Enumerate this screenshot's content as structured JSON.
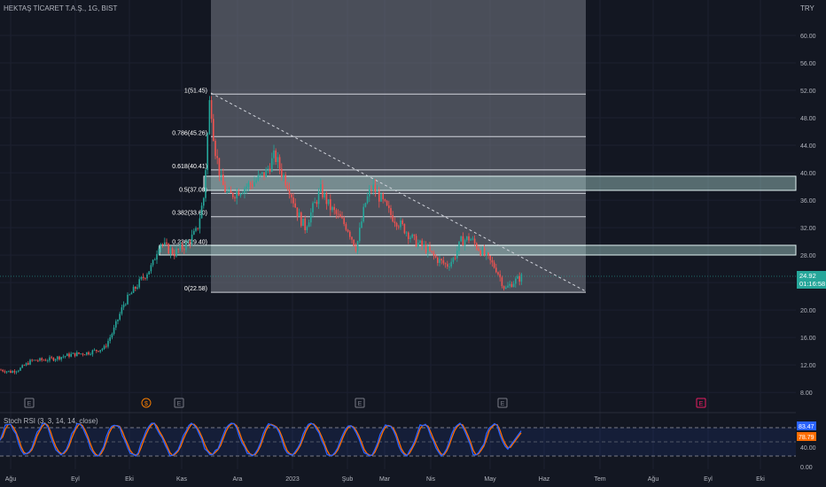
{
  "header": {
    "symbol_title": "HEKTAŞ TİCARET T.A.Ş., 1G, BIST",
    "currency": "TRY"
  },
  "colors": {
    "background": "#131722",
    "grid": "#1c2030",
    "axis_text": "#b2b5be",
    "up": "#26a69a",
    "down": "#ef5350",
    "fib_zone": "#787b86",
    "fib_line": "#d1d4dc",
    "resistance_band": "#b2dfdb",
    "rsi_k": "#2962ff",
    "rsi_d": "#ff6d00",
    "rsi_band": "#2962ff",
    "event_orange": "#f57c00",
    "event_pink": "#e91e63"
  },
  "price_axis": {
    "ticks": [
      "60.00",
      "56.00",
      "52.00",
      "48.00",
      "44.00",
      "40.00",
      "36.00",
      "32.00",
      "28.00",
      "24.00",
      "20.00",
      "16.00",
      "12.00",
      "8.00"
    ]
  },
  "time_axis": {
    "labels": [
      "Ağu",
      "Eyl",
      "Eki",
      "Kas",
      "Ara",
      "2023",
      "Şub",
      "Mar",
      "Nis",
      "May",
      "Haz",
      "Tem",
      "Ağu",
      "Eyl",
      "Eki"
    ]
  },
  "last_price": {
    "value": "24.92",
    "countdown": "01:16:58"
  },
  "fibonacci": {
    "levels": [
      {
        "label": "1(51.45)",
        "price": 51.45
      },
      {
        "label": "0.786(45.26)",
        "price": 45.26
      },
      {
        "label": "0.618(40.41)",
        "price": 40.41
      },
      {
        "label": "0.5(37.00)",
        "price": 37.0
      },
      {
        "label": "0.382(33.60)",
        "price": 33.6
      },
      {
        "label": "0.236(29.40)",
        "price": 29.4
      },
      {
        "label": "0(22.58)",
        "price": 22.58
      }
    ]
  },
  "events": [
    {
      "label": "E",
      "kind": "earnings"
    },
    {
      "label": "$",
      "kind": "dividend"
    },
    {
      "label": "E",
      "kind": "earnings"
    },
    {
      "label": "E",
      "kind": "earnings"
    },
    {
      "label": "E",
      "kind": "earnings"
    },
    {
      "label": "E",
      "kind": "earnings-upcoming"
    }
  ],
  "stoch_rsi": {
    "title": "Stoch RSI (3, 3, 14, 14, close)",
    "k_value": "83.47",
    "d_value": "78.79",
    "axis_ticks": [
      "40.00",
      "0.00"
    ]
  },
  "chart_data": {
    "type": "candlestick",
    "title": "HEKTAŞ TİCARET T.A.Ş., 1G, BIST",
    "ylabel": "TRY",
    "ylim": [
      8,
      60
    ],
    "last_close": 24.92,
    "fib_retracement": {
      "high": 51.45,
      "low": 22.58
    },
    "resistance_zones": [
      [
        37.3,
        39.3
      ],
      [
        27.9,
        29.4
      ]
    ],
    "close_path": [
      [
        "Ağu",
        11.3
      ],
      [
        "Eyl",
        13.5
      ],
      [
        "Eki",
        14.5
      ],
      [
        "Kas",
        30.0
      ],
      [
        "Kas",
        51.45
      ],
      [
        "Ara",
        39.0
      ],
      [
        "Ara",
        43.0
      ],
      [
        "2023",
        33.0
      ],
      [
        "Şub",
        35.0
      ],
      [
        "Mar",
        30.0
      ],
      [
        "Nis",
        28.0
      ],
      [
        "May",
        23.0
      ],
      [
        "May",
        24.92
      ]
    ],
    "stoch_rsi_k_path": [
      [
        "Ağu",
        70
      ],
      [
        "Eyl",
        20
      ],
      [
        "Eki",
        90
      ],
      [
        "Kas",
        95
      ],
      [
        "Ara",
        15
      ],
      [
        "2023",
        90
      ],
      [
        "Şub",
        10
      ],
      [
        "Mar",
        80
      ],
      [
        "Nis",
        5
      ],
      [
        "May",
        10
      ],
      [
        "May",
        83.47
      ]
    ]
  }
}
